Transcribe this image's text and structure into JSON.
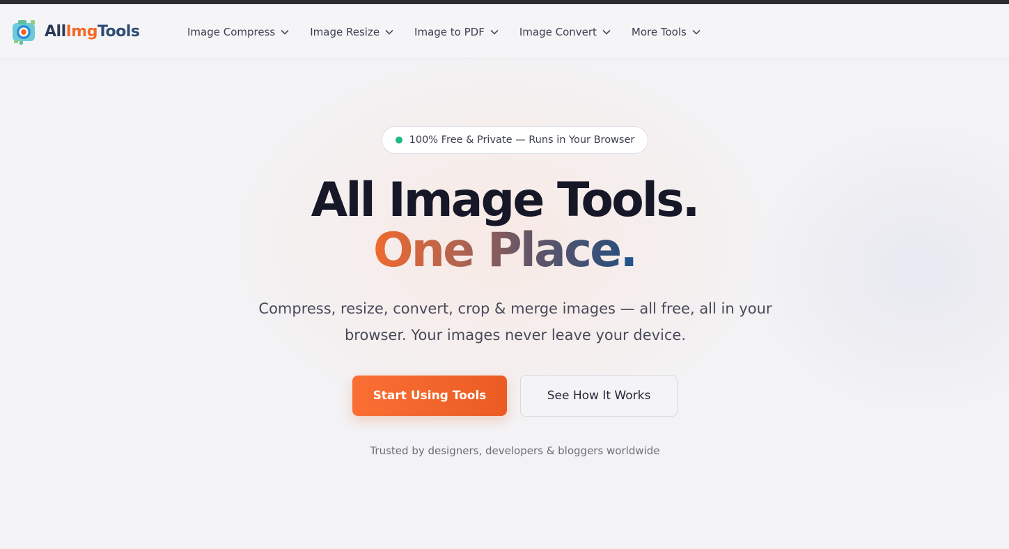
{
  "brand": {
    "part1": "All",
    "part2": "Img",
    "part3": "Tools",
    "colors": {
      "navy": "#2d3a56",
      "orange": "#f26a2a",
      "blue": "#2d4d74"
    }
  },
  "nav": {
    "items": [
      {
        "label": "Image Compress",
        "icon": "chevron-down-icon"
      },
      {
        "label": "Image Resize",
        "icon": "chevron-down-icon"
      },
      {
        "label": "Image to PDF",
        "icon": "chevron-down-icon"
      },
      {
        "label": "Image Convert",
        "icon": "chevron-down-icon"
      },
      {
        "label": "More Tools",
        "icon": "chevron-down-icon"
      }
    ]
  },
  "hero": {
    "badge": "100% Free & Private — Runs in Your Browser",
    "headline_line1": "All Image Tools.",
    "headline_line2": "One Place",
    "headline_dot": ".",
    "subtitle": "Compress, resize, convert, crop & merge images — all free, all in your browser. Your images never leave your device.",
    "primary_button": "Start Using Tools",
    "secondary_button": "See How It Works",
    "trusted_text": "Trusted by designers, developers & bloggers worldwide",
    "colors": {
      "accent": "#f26a2a",
      "badge_dot": "#1fb985",
      "headline": "#161828"
    }
  }
}
